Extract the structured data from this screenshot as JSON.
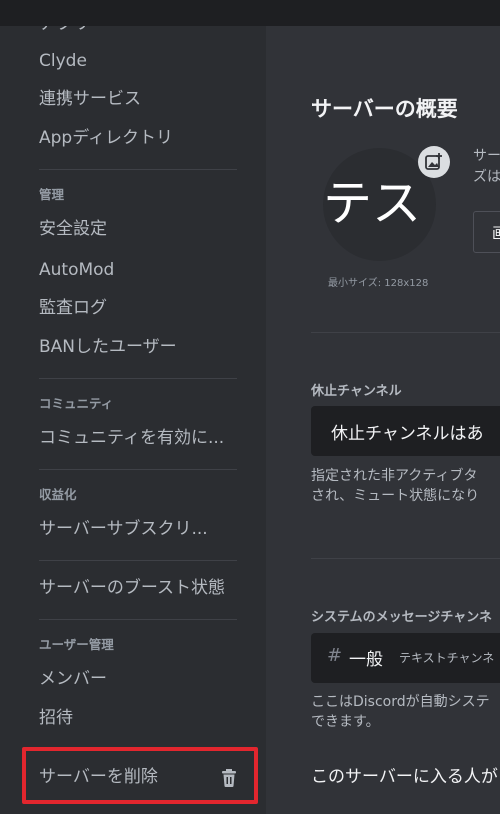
{
  "sidebar": {
    "clipped_item": "アプリ",
    "items_top": [
      "Clyde",
      "連携サービス",
      "Appディレクトリ"
    ],
    "sections": [
      {
        "header": "管理",
        "items": [
          "安全設定",
          "AutoMod",
          "監査ログ",
          "BANしたユーザー"
        ]
      },
      {
        "header": "コミュニティ",
        "items": [
          "コミュニティを有効に..."
        ]
      },
      {
        "header": "収益化",
        "items": [
          "サーバーサブスクリ..."
        ]
      },
      {
        "header": "",
        "items": [
          "サーバーのブースト状態"
        ]
      },
      {
        "header": "ユーザー管理",
        "items": [
          "メンバー",
          "招待"
        ]
      }
    ],
    "delete_label": "サーバーを削除",
    "delete_icon": "trash-icon",
    "highlight_color": "#e2262e"
  },
  "main": {
    "title": "サーバーの概要",
    "server_icon_text": "テスト",
    "upload_icon": "image-plus-icon",
    "min_size": "最小サイズ: 128x128",
    "hint_lines": [
      "サー",
      "ズは"
    ],
    "upload_button_label": "画",
    "afk_label": "休止チャンネル",
    "afk_value": "休止チャンネルはあ",
    "afk_desc_lines": [
      "指定された非アクティブタ",
      "され、ミュート状態になり"
    ],
    "system_label": "システムのメッセージチャンネ",
    "system_channel_name": "一般",
    "system_channel_category": "テキストチャンネ",
    "system_desc_lines": [
      "ここはDiscordが自動システ",
      "できます。"
    ],
    "bottom_text": "このサーバーに入る人が"
  },
  "colors": {
    "sidebar_bg": "#2b2d31",
    "main_bg": "#313338",
    "topbar_bg": "#1e1f22"
  }
}
